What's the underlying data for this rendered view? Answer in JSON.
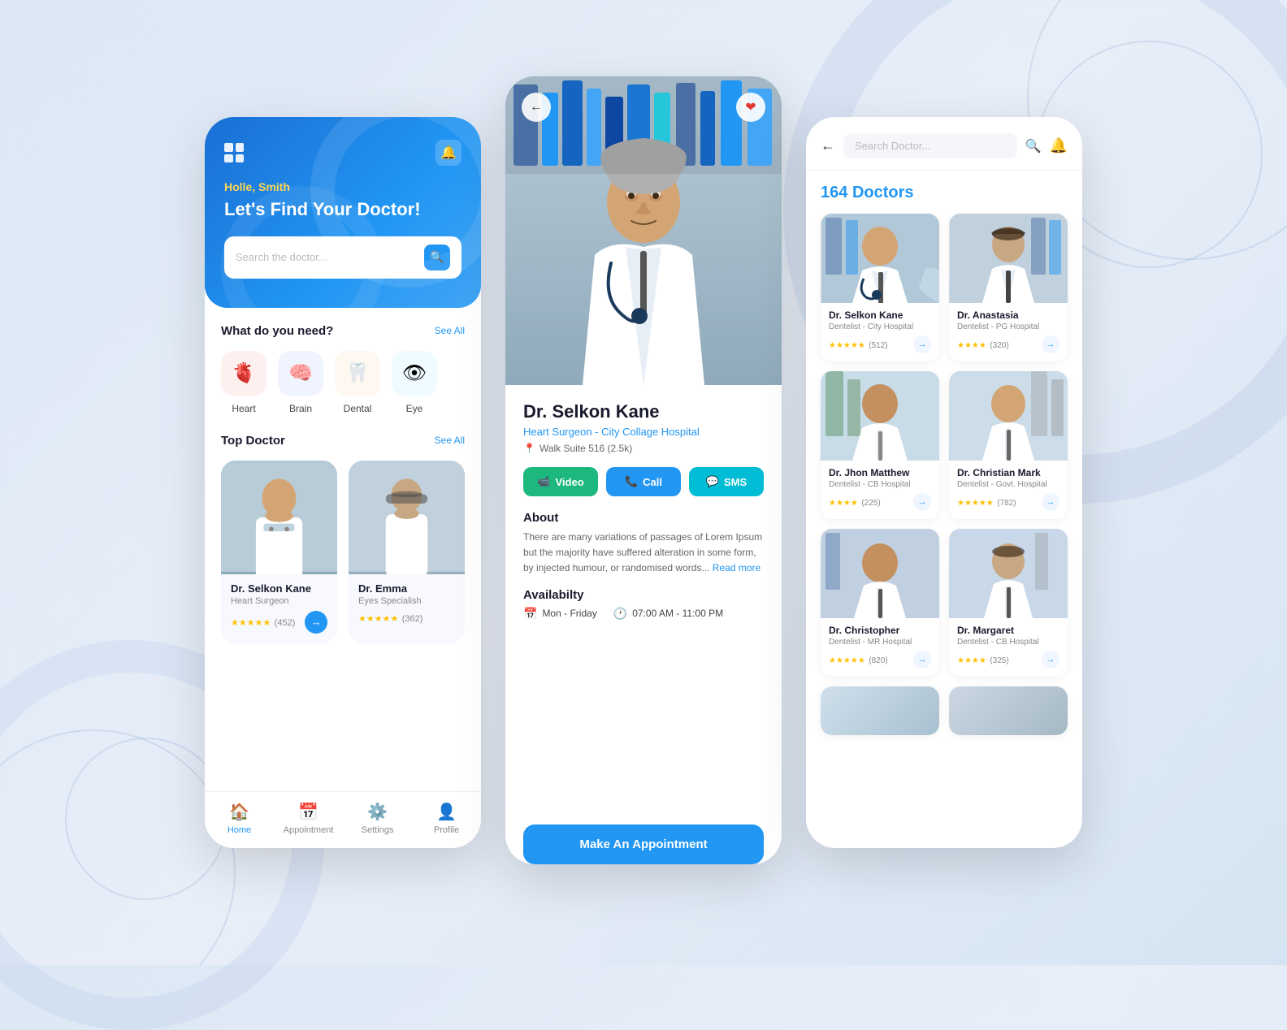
{
  "background": {
    "color": "#dce8f5"
  },
  "phone1": {
    "header": {
      "greeting": "Holle, Smith",
      "title": "Let's Find Your Doctor!",
      "search_placeholder": "Search the doctor..."
    },
    "categories": {
      "section_title": "What do you need?",
      "see_all": "See All",
      "items": [
        {
          "label": "Heart",
          "icon": "🫀",
          "bg": "cat-heart"
        },
        {
          "label": "Brain",
          "icon": "🧠",
          "bg": "cat-brain"
        },
        {
          "label": "Dental",
          "icon": "🦷",
          "bg": "cat-dental"
        },
        {
          "label": "Eye",
          "icon": "👁",
          "bg": "cat-eye"
        }
      ]
    },
    "top_doctor": {
      "section_title": "Top Doctor",
      "see_all": "See All",
      "doctors": [
        {
          "name": "Dr. Selkon Kane",
          "specialty": "Heart Surgeon",
          "rating": "★★★★★",
          "reviews": "(452)"
        },
        {
          "name": "Dr. Emma",
          "specialty": "Eyes Specialish",
          "rating": "★★★★★",
          "reviews": "(362)"
        }
      ]
    },
    "nav": {
      "items": [
        {
          "label": "Home",
          "icon": "🏠",
          "active": true
        },
        {
          "label": "Appointment",
          "icon": "📅",
          "active": false
        },
        {
          "label": "Settings",
          "icon": "⚙️",
          "active": false
        },
        {
          "label": "Profile",
          "icon": "👤",
          "active": false
        }
      ]
    }
  },
  "phone2": {
    "doctor": {
      "name": "Dr. Selkon Kane",
      "specialty": "Heart Surgeon - City Collage Hospital",
      "location": "Walk Suite 516 (2.5k)",
      "about_title": "About",
      "about_text": "There are many variations of passages of Lorem Ipsum but the majority have suffered alteration in some form, by injected humour, or randomised words...",
      "read_more": "Read more",
      "availability_title": "Availabilty",
      "days": "Mon - Friday",
      "hours": "07:00 AM - 11:00 PM",
      "appointment_btn": "Make An Appointment"
    },
    "actions": [
      {
        "label": "Video",
        "icon": "📹",
        "class": "btn-video"
      },
      {
        "label": "Call",
        "icon": "📞",
        "class": "btn-call"
      },
      {
        "label": "SMS",
        "icon": "💬",
        "class": "btn-sms"
      }
    ]
  },
  "phone3": {
    "search": {
      "placeholder": "Search Doctor..."
    },
    "count_label": "Doctors",
    "count_number": "164",
    "doctors": [
      {
        "name": "Dr. Selkon Kane",
        "specialty": "Dentelist - City Hospital",
        "rating": "★★★★★",
        "reviews": "(512)"
      },
      {
        "name": "Dr. Anastasia",
        "specialty": "Dentelist - PG Hospital",
        "rating": "★★★★",
        "reviews": "(320)"
      },
      {
        "name": "Dr. Jhon Matthew",
        "specialty": "Dentelist - CB Hospital",
        "rating": "★★★★",
        "reviews": "(225)"
      },
      {
        "name": "Dr. Christian Mark",
        "specialty": "Dentelist - Govt. Hospital",
        "rating": "★★★★★",
        "reviews": "(782)"
      },
      {
        "name": "Dr. Christopher",
        "specialty": "Dentelist - MR Hospital",
        "rating": "★★★★★",
        "reviews": "(820)"
      },
      {
        "name": "Dr. Margaret",
        "specialty": "Dentelist - CB Hospital",
        "rating": "★★★★",
        "reviews": "(325)"
      }
    ]
  }
}
